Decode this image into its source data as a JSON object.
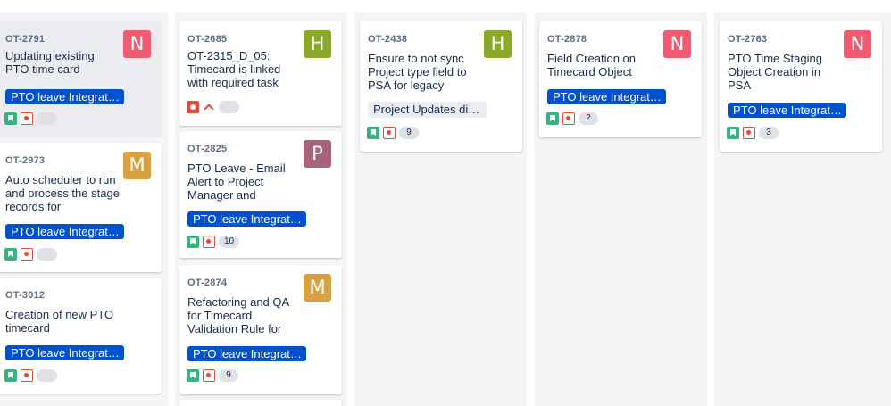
{
  "columns": [
    {
      "cards": [
        {
          "key": "OT-2791",
          "summary": "Updating existing PTO time card",
          "avatar": "N",
          "avatar_color": "#f15b71",
          "epic": "PTO leave Integrat…",
          "issue_type": "story-icon",
          "priority": "bug-icon",
          "points": ""
        },
        {
          "key": "OT-2973",
          "summary": "Auto scheduler to run and process the stage records for",
          "avatar": "M",
          "avatar_color": "#d9a142",
          "epic": "PTO leave Integrat…",
          "issue_type": "story-icon",
          "priority": "bug-icon",
          "points": ""
        },
        {
          "key": "OT-3012",
          "summary": "Creation of new PTO timecard",
          "avatar": "",
          "avatar_color": "",
          "epic": "PTO leave Integrat…",
          "issue_type": "story-icon",
          "priority": "bug-icon",
          "points": ""
        }
      ]
    },
    {
      "cards": [
        {
          "key": "OT-2685",
          "summary": "OT-2315_D_05: Timecard is linked with required task",
          "avatar": "H",
          "avatar_color": "#8aa82a",
          "epic": "",
          "issue_type": "bug-red-icon",
          "priority": "priority-high-icon",
          "points": ""
        },
        {
          "key": "OT-2825",
          "summary": "PTO Leave - Email Alert to Project Manager and",
          "avatar": "P",
          "avatar_color": "#a8637a",
          "epic": "PTO leave Integrat…",
          "issue_type": "story-icon",
          "priority": "bug-icon",
          "points": "10"
        },
        {
          "key": "OT-2874",
          "summary": "Refactoring and QA for Timecard Validation Rule for",
          "avatar": "M",
          "avatar_color": "#d9a142",
          "epic": "PTO leave Integrat…",
          "issue_type": "story-icon",
          "priority": "bug-icon",
          "points": "9"
        }
      ]
    },
    {
      "cards": [
        {
          "key": "OT-2438",
          "summary": "Ensure to not sync Project type field to PSA for legacy",
          "avatar": "H",
          "avatar_color": "#8aa82a",
          "label": "Project Updates di…",
          "issue_type": "story-icon",
          "priority": "bug-icon",
          "points": "9"
        }
      ]
    },
    {
      "cards": [
        {
          "key": "OT-2878",
          "summary": "Field Creation on Timecard Object",
          "avatar": "N",
          "avatar_color": "#f15b71",
          "epic": "PTO leave Integrat…",
          "issue_type": "story-icon",
          "priority": "bug-icon",
          "points": "2"
        }
      ]
    },
    {
      "cards": [
        {
          "key": "OT-2763",
          "summary": "PTO Time Staging Object Creation in PSA",
          "avatar": "N",
          "avatar_color": "#f15b71",
          "epic": "PTO leave Integrat…",
          "issue_type": "story-icon",
          "priority": "bug-icon",
          "points": "3"
        }
      ]
    }
  ],
  "colors": {
    "column_bg": "#f4f5f7",
    "epic_bg": "#0052cc",
    "story": "#36b37e",
    "bug": "#e5493a"
  }
}
